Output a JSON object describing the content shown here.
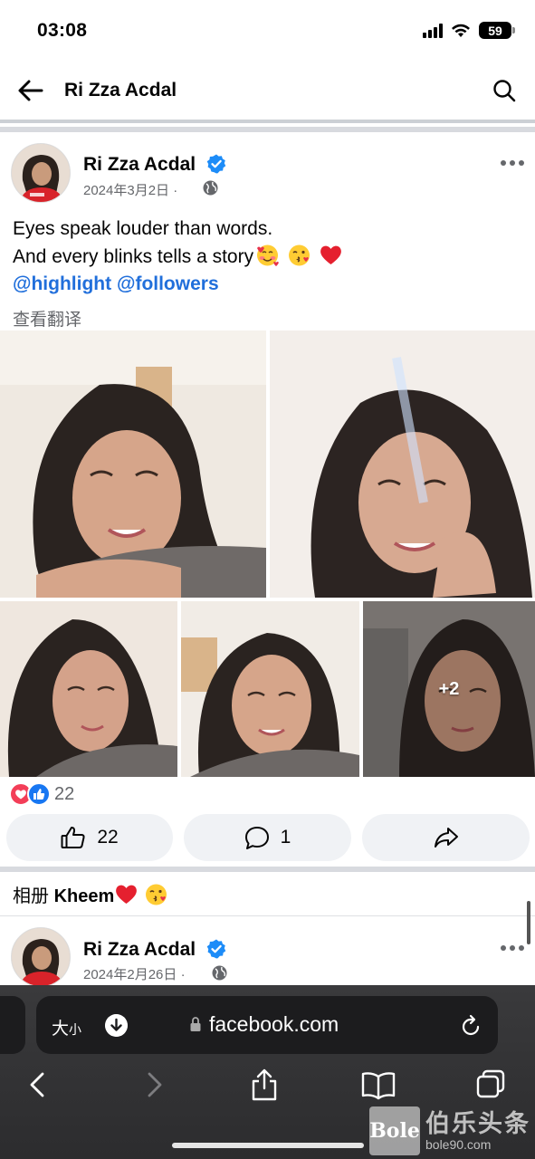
{
  "status_bar": {
    "time": "03:08",
    "battery": "59"
  },
  "nav": {
    "title": "Ri Zza Acdal"
  },
  "post": {
    "author": "Ri Zza Acdal",
    "date": "2024年3月2日 ·",
    "text_line1": "Eyes speak louder than words.",
    "text_line2": "And every blinks tells a story",
    "mention1": "@highlight",
    "mention2": "@followers",
    "translate": "查看翻译",
    "more_photos": "+2",
    "reaction_count": "22",
    "like_count": "22",
    "comment_count": "1"
  },
  "album": {
    "prefix": "相册",
    "name": "Kheem"
  },
  "next_post": {
    "author": "Ri Zza Acdal",
    "date": "2024年2月26日 ·"
  },
  "browser": {
    "text_size": "大",
    "text_size_small": "小",
    "url": "facebook.com"
  },
  "watermark": {
    "logo": "Bole",
    "name": "伯乐头条",
    "url": "bole90.com"
  },
  "colors": {
    "accent": "#216fdb",
    "verified": "#1d8cf8",
    "love": "#f33e58",
    "like": "#1877f2"
  }
}
